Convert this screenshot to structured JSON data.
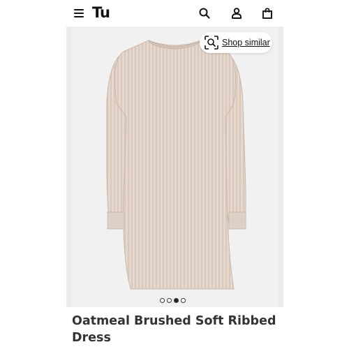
{
  "header": {
    "logo_text": "Tu",
    "icons": [
      "menu-icon",
      "search-icon",
      "account-icon",
      "bag-icon"
    ]
  },
  "gallery": {
    "shop_similar_label": "Shop similar",
    "image_count": 4,
    "active_image_index": 3,
    "dress_color": "#e2d4c8"
  },
  "product": {
    "title": "Oatmeal Brushed Soft Ribbed Dress"
  }
}
